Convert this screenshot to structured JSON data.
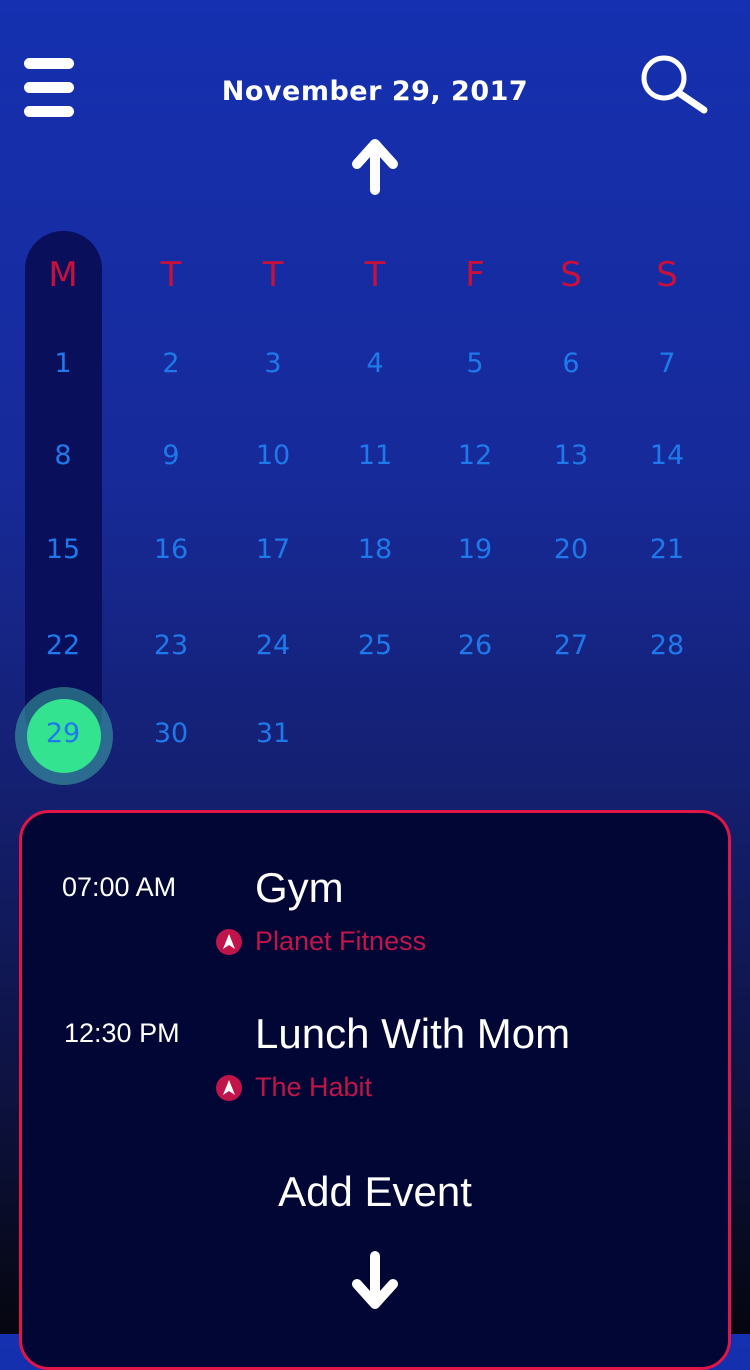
{
  "header": {
    "date_title": "November 29, 2017",
    "menu_icon": "hamburger-menu-icon",
    "search_icon": "search-icon",
    "up_icon": "arrow-up-icon"
  },
  "calendar": {
    "weekday_headers": [
      "M",
      "T",
      "T",
      "T",
      "F",
      "S",
      "S"
    ],
    "days": [
      "1",
      "2",
      "3",
      "4",
      "5",
      "6",
      "7",
      "8",
      "9",
      "10",
      "11",
      "12",
      "13",
      "14",
      "15",
      "16",
      "17",
      "18",
      "19",
      "20",
      "21",
      "22",
      "23",
      "24",
      "25",
      "26",
      "27",
      "28",
      "29",
      "30",
      "31"
    ],
    "selected_day": "29",
    "colors": {
      "weekday": "#c8103b",
      "day": "#1f79ea",
      "selected": "#33e390",
      "monday_highlight": "#090f5a"
    }
  },
  "events": {
    "items": [
      {
        "time": "07:00 AM",
        "title": "Gym",
        "location": "Planet Fitness"
      },
      {
        "time": "12:30 PM",
        "title": "Lunch With Mom",
        "location": "The Habit"
      }
    ],
    "location_icon": "location-pin-icon",
    "add_label": "Add Event",
    "down_icon": "arrow-down-icon",
    "colors": {
      "panel": "#020634",
      "border": "#e01548",
      "location": "#c0154a"
    }
  }
}
